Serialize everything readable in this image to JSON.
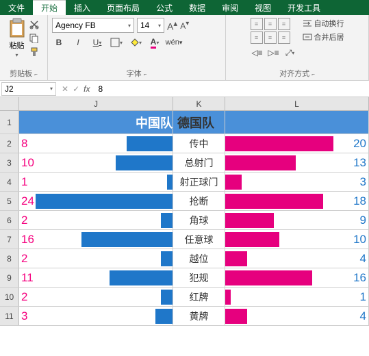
{
  "tabs": {
    "file": "文件",
    "home": "开始",
    "insert": "插入",
    "layout": "页面布局",
    "formula": "公式",
    "data": "数据",
    "review": "审阅",
    "view": "视图",
    "dev": "开发工具"
  },
  "ribbon": {
    "paste": "粘贴",
    "clipboard": "剪贴板",
    "font_group": "字体",
    "align_group": "对齐方式",
    "font_name": "Agency FB",
    "font_size": "14",
    "bold": "B",
    "italic": "I",
    "underline": "U",
    "wrap": "自动换行",
    "merge": "合并后居"
  },
  "formula": {
    "namebox": "J2",
    "fx": "fx",
    "value": "8"
  },
  "cols": {
    "J": "J",
    "K": "K",
    "L": "L"
  },
  "header": {
    "J": "中国队",
    "L": "德国队"
  },
  "rownums": [
    "1",
    "2",
    "3",
    "4",
    "5",
    "6",
    "7",
    "8",
    "9",
    "10",
    "11"
  ],
  "stats": [
    {
      "j": "8",
      "k": "传中",
      "l": "20"
    },
    {
      "j": "10",
      "k": "总射门",
      "l": "13"
    },
    {
      "j": "1",
      "k": "射正球门",
      "l": "3"
    },
    {
      "j": "24",
      "k": "抢断",
      "l": "18"
    },
    {
      "j": "2",
      "k": "角球",
      "l": "9"
    },
    {
      "j": "16",
      "k": "任意球",
      "l": "10"
    },
    {
      "j": "2",
      "k": "越位",
      "l": "4"
    },
    {
      "j": "11",
      "k": "犯规",
      "l": "16"
    },
    {
      "j": "2",
      "k": "红牌",
      "l": "1"
    },
    {
      "j": "3",
      "k": "黄牌",
      "l": "4"
    }
  ],
  "chart_data": {
    "type": "bar",
    "series": [
      {
        "name": "中国队",
        "values": [
          8,
          10,
          1,
          24,
          2,
          16,
          2,
          11,
          2,
          3
        ]
      },
      {
        "name": "德国队",
        "values": [
          20,
          13,
          3,
          18,
          9,
          10,
          4,
          16,
          1,
          4
        ]
      }
    ],
    "categories": [
      "传中",
      "总射门",
      "射正球门",
      "抢断",
      "角球",
      "任意球",
      "越位",
      "犯规",
      "红牌",
      "黄牌"
    ],
    "title": "",
    "xlabel": "",
    "ylabel": ""
  },
  "colors": {
    "accent": "#217346",
    "blue": "#1f77c9",
    "pink": "#e6007e",
    "header_blue": "#4a90d9"
  }
}
